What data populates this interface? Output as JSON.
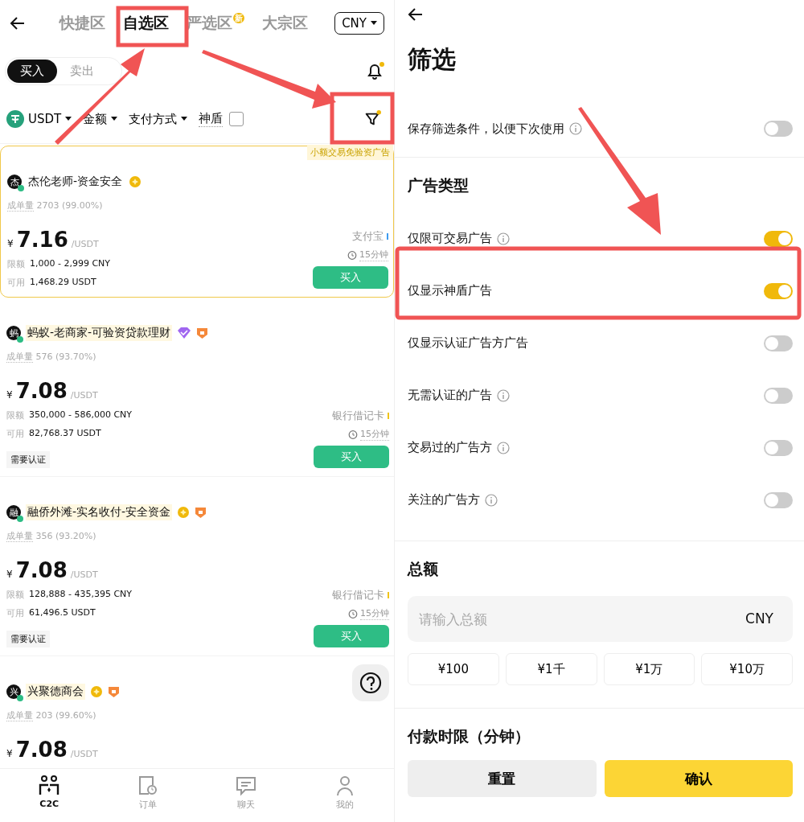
{
  "market": {
    "tabs": [
      {
        "label": "快捷区",
        "selected": false
      },
      {
        "label": "自选区",
        "selected": true
      },
      {
        "label": "严选区",
        "selected": false,
        "badge": "新"
      },
      {
        "label": "大宗区",
        "selected": false
      }
    ],
    "currency": "CNY",
    "sides": [
      {
        "label": "买入",
        "selected": true
      },
      {
        "label": "卖出",
        "selected": false
      }
    ],
    "filters": [
      {
        "label": "USDT",
        "kind": "coin"
      },
      {
        "label": "金额",
        "kind": "dropdown"
      },
      {
        "label": "支付方式",
        "kind": "dropdown"
      }
    ],
    "shield": {
      "label": "神盾",
      "checked": false
    },
    "listings": [
      {
        "featured": true,
        "tag": "小额交易免验资广告",
        "avatar": "杰",
        "name": "杰伦老师-资金安全",
        "highlighted": false,
        "badges": [
          {
            "kind": "gold"
          }
        ],
        "stats_label": "成单量",
        "stats": "2703 (99.00%)",
        "symbol": "¥",
        "price": "7.16",
        "unit": "/USDT",
        "limit_label": "限额",
        "limit": "1,000 - 2,999 CNY",
        "available_label": "可用",
        "available": "1,468.29 USDT",
        "payment": "支付宝",
        "color": "#3d9bf0",
        "time": "15分钟",
        "button": "买入"
      },
      {
        "featured": false,
        "avatar": "蚂",
        "name": "蚂蚁-老商家-可验资贷款理财",
        "highlighted": true,
        "badges": [
          {
            "kind": "diamond"
          },
          {
            "kind": "shield"
          }
        ],
        "stats_label": "成单量",
        "stats": "576 (93.70%)",
        "symbol": "¥",
        "price": "7.08",
        "unit": "/USDT",
        "limit_label": "限额",
        "limit": "350,000 - 586,000 CNY",
        "available_label": "可用",
        "available": "82,768.37 USDT",
        "payment": "银行借记卡",
        "color": "#f0c419",
        "time": "15分钟",
        "button": "买入",
        "verify": "需要认证"
      },
      {
        "featured": false,
        "avatar": "融",
        "name": "融侨外滩-实名收付-安全资金",
        "highlighted": true,
        "badges": [
          {
            "kind": "gold"
          },
          {
            "kind": "shield"
          }
        ],
        "stats_label": "成单量",
        "stats": "356 (93.20%)",
        "symbol": "¥",
        "price": "7.08",
        "unit": "/USDT",
        "limit_label": "限额",
        "limit": "128,888 - 435,395 CNY",
        "available_label": "可用",
        "available": "61,496.5 USDT",
        "payment": "银行借记卡",
        "color": "#f0c419",
        "time": "15分钟",
        "button": "买入",
        "verify": "需要认证"
      },
      {
        "featured": false,
        "avatar": "兴",
        "name": "兴聚德商会",
        "highlighted": true,
        "badges": [
          {
            "kind": "gold"
          },
          {
            "kind": "shield"
          }
        ],
        "stats_label": "成单量",
        "stats": "203 (99.60%)",
        "symbol": "¥",
        "price": "7.08",
        "unit": "/USDT"
      }
    ],
    "nav": [
      {
        "label": "C2C",
        "kind": "c2c",
        "selected": true
      },
      {
        "label": "订单",
        "kind": "orders",
        "selected": false
      },
      {
        "label": "聊天",
        "kind": "chat",
        "selected": false
      },
      {
        "label": "我的",
        "kind": "me",
        "selected": false
      }
    ]
  },
  "filter_panel": {
    "title": "筛选",
    "save": {
      "label": "保存筛选条件，以便下次使用",
      "info": true,
      "on": false
    },
    "ad_type_title": "广告类型",
    "options": [
      {
        "label": "仅限可交易广告",
        "info": true,
        "on": true
      },
      {
        "label": "仅显示神盾广告",
        "info": false,
        "on": true
      },
      {
        "label": "仅显示认证广告方广告",
        "info": false,
        "on": false
      },
      {
        "label": "无需认证的广告",
        "info": true,
        "on": false
      },
      {
        "label": "交易过的广告方",
        "info": true,
        "on": false
      },
      {
        "label": "关注的广告方",
        "info": true,
        "on": false
      }
    ],
    "amount_title": "总额",
    "amount": {
      "placeholder": "请输入总额",
      "unit": "CNY"
    },
    "quick_amounts": [
      "¥100",
      "¥1千",
      "¥1万",
      "¥10万"
    ],
    "time_title": "付款时限（分钟）",
    "buttons": [
      {
        "label": "重置",
        "kind": "reset"
      },
      {
        "label": "确认",
        "kind": "confirm"
      }
    ]
  }
}
